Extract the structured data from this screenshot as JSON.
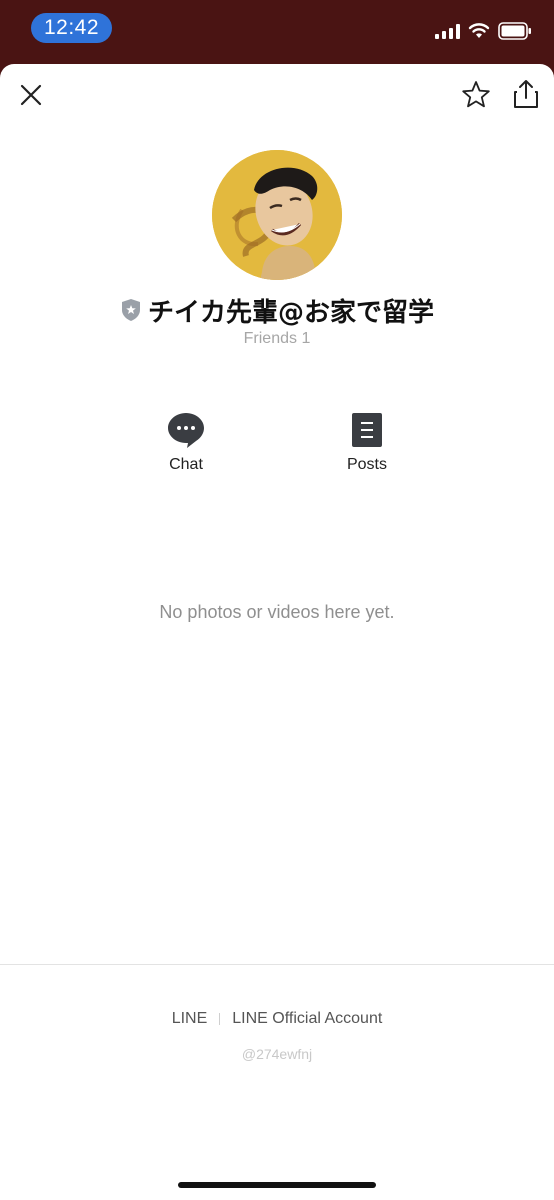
{
  "status_bar": {
    "time": "12:42",
    "icons": [
      "signal-icon",
      "wifi-icon",
      "battery-icon"
    ]
  },
  "header": {
    "icons": [
      "close-icon",
      "star-icon",
      "share-icon"
    ]
  },
  "profile": {
    "name": "チイカ先輩@お家で留学",
    "friends": "Friends 1",
    "avatar_color": "#e3b93e",
    "badge_icon": "shield-badge-icon"
  },
  "actions": [
    {
      "label": "Chat",
      "icon": "chat-bubble-icon"
    },
    {
      "label": "Posts",
      "icon": "posts-icon"
    }
  ],
  "empty_message": "No photos or videos here yet.",
  "footer": {
    "brand": "LINE",
    "account_type": "LINE Official Account",
    "line_id": "@274ewfnj"
  },
  "colors": {
    "status_bar_bg": "#4a1413",
    "time_pill": "#2f73d9"
  }
}
